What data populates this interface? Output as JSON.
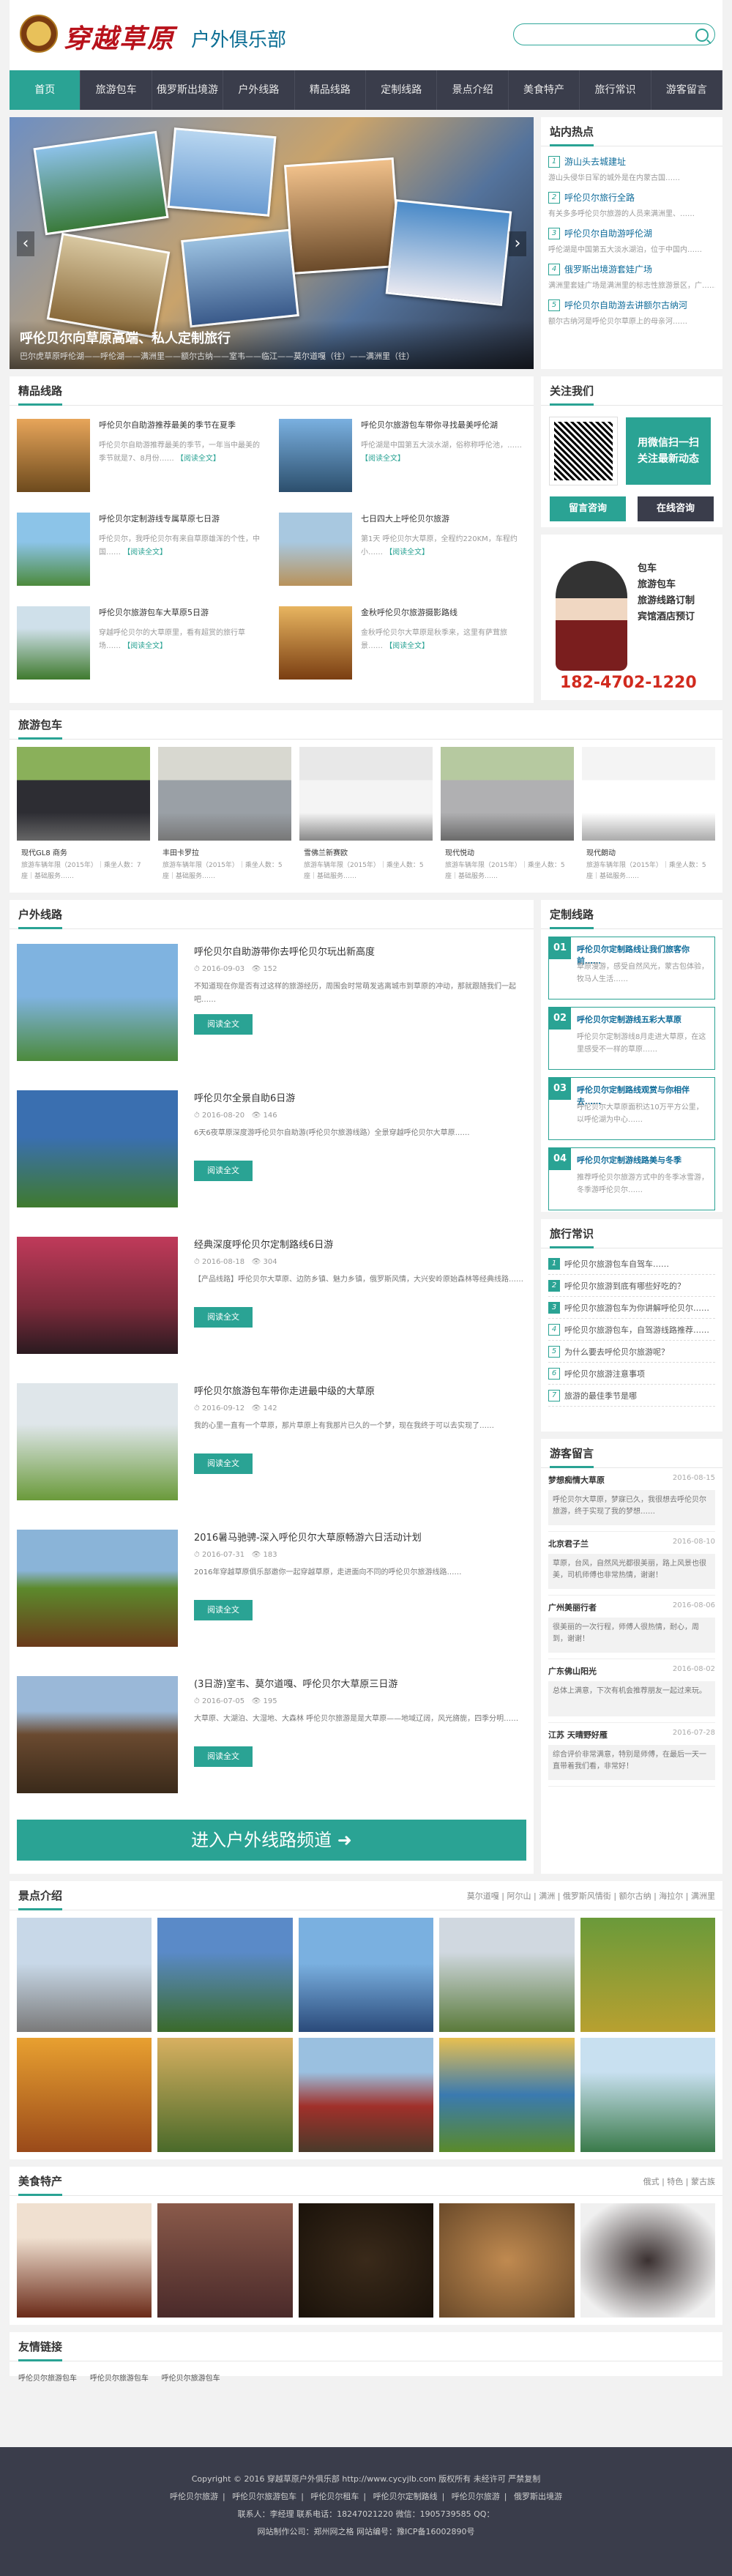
{
  "header": {
    "logo_calligraphy": "穿越草原",
    "club_name": "户外俱乐部",
    "search_placeholder": ""
  },
  "nav": [
    "首页",
    "旅游包车",
    "俄罗斯出境游",
    "户外线路",
    "精品线路",
    "定制线路",
    "景点介绍",
    "美食特产",
    "旅行常识",
    "游客留言"
  ],
  "slider": {
    "title": "呼伦贝尔向草原高端、私人定制旅行",
    "subtitle": "巴尔虎草原呼伦湖——呼伦湖——满洲里——额尔古纳——室韦——临江——莫尔道嘎（往）——满洲里（往）"
  },
  "hot": {
    "title": "站内热点",
    "items": [
      {
        "t": "游山头去城建址",
        "d": "游山头侵华日军的城外是在内蒙古国……"
      },
      {
        "t": "呼伦贝尔旅行全路",
        "d": "有关多多呼伦贝尔旅游的人员来满洲里、……"
      },
      {
        "t": "呼伦贝尔自助游呼伦湖",
        "d": "呼伦湖是中国第五大淡水湖泊，位于中国内……"
      },
      {
        "t": "俄罗斯出境游套娃广场",
        "d": "满洲里套娃广场是满洲里的标志性旅游景区，广……"
      },
      {
        "t": "呼伦贝尔自助游去讲额尔古纳河",
        "d": "额尔古纳河是呼伦贝尔草原上的母亲河……"
      }
    ]
  },
  "premium": {
    "title": "精品线路",
    "items": [
      {
        "t": "呼伦贝尔自助游推荐最美的季节在夏季",
        "d": "呼伦贝尔自助游推荐最美的季节，一年当中最美的季节就是7、8月份……",
        "m": "【阅读全文】"
      },
      {
        "t": "呼伦贝尔旅游包车带你寻找最美呼伦湖",
        "d": "呼伦湖是中国第五大淡水湖，俗称称呼伦池，……",
        "m": "【阅读全文】"
      },
      {
        "t": "呼伦贝尔定制游线专属草原七日游",
        "d": "呼伦贝尔，我呼伦贝尔有来自草原雄浑的个性，中国……",
        "m": "【阅读全文】"
      },
      {
        "t": "七日四大上呼伦贝尔旅游",
        "d": "第1天 呼伦贝尔大草原，全程约220KM，车程约小……",
        "m": "【阅读全文】"
      },
      {
        "t": "呼伦贝尔旅游包车大草原5日游",
        "d": "穿越呼伦贝尔的大草原里，看有超赏的旅行草场……",
        "m": "【阅读全文】"
      },
      {
        "t": "金秋呼伦贝尔旅游摄影路线",
        "d": "金秋呼伦贝尔大草原是秋季来，这里有萨茸旅景……",
        "m": "【阅读全文】"
      }
    ]
  },
  "follow": {
    "title": "关注我们",
    "wx_text": "用微信扫一扫\n关注最新动态",
    "btn1": "留言咨询",
    "btn2": "在线咨询"
  },
  "ad": {
    "slogan": "包车\n旅游包车\n旅游线路订制\n宾馆酒店预订",
    "tel": "182-4702-1220"
  },
  "cars": {
    "title": "旅游包车",
    "items": [
      {
        "t": "现代GL8 商务",
        "d": "旅游车辆年限（2015年）｜乘坐人数：7座｜基础服务……"
      },
      {
        "t": "丰田卡罗拉",
        "d": "旅游车辆年限（2015年）｜乘坐人数：5座｜基础服务……"
      },
      {
        "t": "雪佛兰新赛欧",
        "d": "旅游车辆年限（2015年）｜乘坐人数：5座｜基础服务……"
      },
      {
        "t": "现代悦动",
        "d": "旅游车辆年限（2015年）｜乘坐人数：5座｜基础服务……"
      },
      {
        "t": "现代朗动",
        "d": "旅游车辆年限（2015年）｜乘坐人数：5座｜基础服务……"
      }
    ]
  },
  "outdoor": {
    "title": "户外线路",
    "read": "阅读全文",
    "big_button": "进入户外线路频道 ➜",
    "items": [
      {
        "t": "呼伦贝尔自助游带你去呼伦贝尔玩出新高度",
        "date": "2016-09-03",
        "views": "152",
        "d": "不知道现在你是否有过这样的旅游经历，周围会时常萌发逃离城市到草原的冲动，那就跟随我们一起吧……"
      },
      {
        "t": "呼伦贝尔全景自助6日游",
        "date": "2016-08-20",
        "views": "146",
        "d": "6天6夜草原深度游呼伦贝尔自助游(呼伦贝尔旅游线路）全景穿越呼伦贝尔大草原……"
      },
      {
        "t": "经典深度呼伦贝尔定制路线6日游",
        "date": "2016-08-18",
        "views": "304",
        "d": "【产品线路】呼伦贝尔大草原、边防乡镇、魅力乡镇，俄罗斯风情，大兴安岭原始森林等经典线路……"
      },
      {
        "t": "呼伦贝尔旅游包车带你走进最中级的大草原",
        "date": "2016-09-12",
        "views": "142",
        "d": "我的心里一直有一个草原，那片草原上有我那片已久的一个梦，现在我终于可以去实现了……"
      },
      {
        "t": "2016暑马驰骋-深入呼伦贝尔大草原畅游六日活动计划",
        "date": "2016-07-31",
        "views": "183",
        "d": "2016年穿越草原俱乐部邀你一起穿越草原，走进面向不同的呼伦贝尔旅游线路……"
      },
      {
        "t": "(3日游)室韦、莫尔道嘎、呼伦贝尔大草原三日游",
        "date": "2016-07-05",
        "views": "195",
        "d": "大草原、大湖泊、大湿地、大森林 呼伦贝尔旅游是是大草原——地域辽阔，风光旖旎，四季分明……"
      }
    ]
  },
  "custom": {
    "title": "定制线路",
    "items": [
      {
        "n": "01",
        "t": "呼伦贝尔定制路线让我们旅客你前……",
        "d": "草原漫游，感受自然风光，蒙古包体验，牧马人生活……"
      },
      {
        "n": "02",
        "t": "呼伦贝尔定制游线五彩大草原",
        "d": "呼伦贝尔定制游线8月走进大草原，在这里感受不一样的草原……"
      },
      {
        "n": "03",
        "t": "呼伦贝尔定制路线观赏与你相伴去……",
        "d": "呼伦贝尔大草原面积达10万平方公里，以呼伦湖为中心……"
      },
      {
        "n": "04",
        "t": "呼伦贝尔定制游线路美与冬季",
        "d": "推荐呼伦贝尔旅游方式中的冬季冰雪游，冬季游呼伦贝尔……"
      }
    ]
  },
  "knowledge": {
    "title": "旅行常识",
    "items": [
      "呼伦贝尔旅游包车自驾车……",
      "呼伦贝尔旅游到底有哪些好吃的？",
      "呼伦贝尔旅游包车为你讲解呼伦贝尔……",
      "呼伦贝尔旅游包车，自驾游线路推荐……",
      "为什么要去呼伦贝尔旅游呢？",
      "呼伦贝尔旅游注意事项",
      "旅游的最佳季节是哪"
    ]
  },
  "messages": {
    "title": "游客留言",
    "items": [
      {
        "n": "梦想痴情大草原",
        "date": "2016-08-15",
        "b": "呼伦贝尔大草原，梦寐已久，我很想去呼伦贝尔旅游，终于实现了我的梦想……"
      },
      {
        "n": "北京君子兰",
        "date": "2016-08-10",
        "b": "草原，台风，自然风光都很美丽，路上风景也很美，司机师傅也非常热情，谢谢！"
      },
      {
        "n": "广州美丽行者",
        "date": "2016-08-06",
        "b": "很美丽的一次行程，师傅人很热情，耐心，周到，谢谢！"
      },
      {
        "n": "广东佛山阳光",
        "date": "2016-08-02",
        "b": "总体上满意，下次有机会推荐朋友一起过来玩。"
      },
      {
        "n": "江苏 天晴野好雁",
        "date": "2016-07-28",
        "b": "综合评价非常满意，特别是师傅，在最后一天一直带着我们看，非常好！"
      }
    ]
  },
  "scenic": {
    "title": "景点介绍",
    "more": "莫尔道嘎 | 阿尔山 | 满洲 | 俄罗斯风情街 | 额尔古纳 | 海拉尔 | 满洲里"
  },
  "food": {
    "title": "美食特产",
    "more": "俄式 | 特色 | 蒙古族"
  },
  "links": {
    "title": "友情链接",
    "items": [
      "呼伦贝尔旅游包车",
      "呼伦贝尔旅游包车",
      "呼伦贝尔旅游包车"
    ]
  },
  "footer": {
    "copy": "Copyright © 2016 穿越草原户外俱乐部 http://www.cycyjlb.com 版权所有 未经许可 严禁复制",
    "links": [
      "呼伦贝尔旅游",
      "呼伦贝尔旅游包车",
      "呼伦贝尔租车",
      "呼伦贝尔定制路线",
      "呼伦贝尔旅游",
      "俄罗斯出境游"
    ],
    "contact": "联系人：李经理  联系电话：18247021220  微信：1905739585  QQ：",
    "addr": "网站制作公司：郑州网之格  网站编号：豫ICP备16002890号"
  }
}
